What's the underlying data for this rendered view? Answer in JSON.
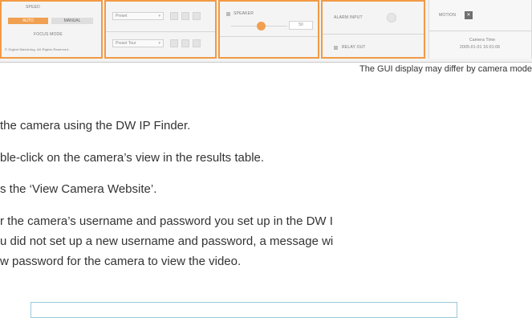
{
  "gui": {
    "speed_label": "SPEED",
    "auto_label": "AUTO",
    "manual_label": "MANUAL",
    "focus_mode_label": "FOCUS MODE",
    "copyright": "© Digital Watchdog. All Rights Reserved.",
    "preset_label": "Preset",
    "preset_tour_label": "Preset Tour",
    "speaker_label": "SPEAKER",
    "speaker_value": "50",
    "alarm_input_label": "ALARM INPUT",
    "relay_out_label": "RELAY OUT",
    "motion_label": "MOTION",
    "camera_time_label": "Camera Time",
    "camera_time_value": "2005-01-01 16:01:06"
  },
  "caption": "The GUI display may differ by camera mode",
  "steps": [
    "the camera using the DW IP Finder.",
    "ble-click on the camera’s view in the results table.",
    "s the ‘View Camera Website’.",
    "r the camera’s username and password you set up in the DW I",
    "u did not set up a new username and password, a message wi",
    "w password for the camera to view the video."
  ]
}
